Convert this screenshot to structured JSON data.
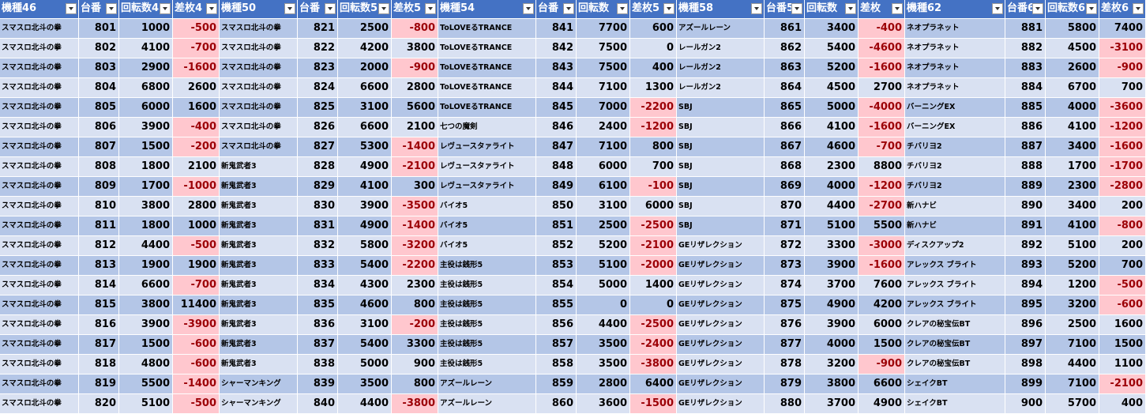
{
  "sheet": {
    "headers": [
      "機種46",
      "台番",
      "回転数4",
      "差枚4",
      "機種50",
      "台番",
      "回転数5",
      "差枚5",
      "機種54",
      "台番",
      "回転数",
      "差枚5",
      "機種58",
      "台番5",
      "回転数",
      "差枚",
      "機種62",
      "台番6",
      "回転数6",
      "差枚6"
    ],
    "rows": [
      [
        "スマスロ北斗の拳",
        "801",
        "1000",
        "-500",
        "スマスロ北斗の拳",
        "821",
        "2500",
        "-800",
        "ToLOVEるTRANCE",
        "841",
        "7700",
        "600",
        "アズールレーン",
        "861",
        "3400",
        "-400",
        "ネオプラネット",
        "881",
        "5800",
        "7400"
      ],
      [
        "スマスロ北斗の拳",
        "802",
        "4100",
        "-700",
        "スマスロ北斗の拳",
        "822",
        "4200",
        "3800",
        "ToLOVEるTRANCE",
        "842",
        "7500",
        "0",
        "レールガン2",
        "862",
        "5400",
        "-4600",
        "ネオプラネット",
        "882",
        "4500",
        "-3100"
      ],
      [
        "スマスロ北斗の拳",
        "803",
        "2900",
        "-1600",
        "スマスロ北斗の拳",
        "823",
        "2000",
        "-900",
        "ToLOVEるTRANCE",
        "843",
        "7500",
        "400",
        "レールガン2",
        "863",
        "5200",
        "-1600",
        "ネオプラネット",
        "883",
        "2600",
        "-900"
      ],
      [
        "スマスロ北斗の拳",
        "804",
        "6800",
        "2600",
        "スマスロ北斗の拳",
        "824",
        "6600",
        "2800",
        "ToLOVEるTRANCE",
        "844",
        "7100",
        "1300",
        "レールガン2",
        "864",
        "4500",
        "2700",
        "ネオプラネット",
        "884",
        "6700",
        "700"
      ],
      [
        "スマスロ北斗の拳",
        "805",
        "6000",
        "1600",
        "スマスロ北斗の拳",
        "825",
        "3100",
        "5600",
        "ToLOVEるTRANCE",
        "845",
        "7000",
        "-2200",
        "SBJ",
        "865",
        "5000",
        "-4000",
        "バーニングEX",
        "885",
        "4000",
        "-3600"
      ],
      [
        "スマスロ北斗の拳",
        "806",
        "3900",
        "-400",
        "スマスロ北斗の拳",
        "826",
        "6600",
        "2100",
        "七つの魔剣",
        "846",
        "2400",
        "-1200",
        "SBJ",
        "866",
        "4100",
        "-1600",
        "バーニングEX",
        "886",
        "4100",
        "-1200"
      ],
      [
        "スマスロ北斗の拳",
        "807",
        "1500",
        "-200",
        "スマスロ北斗の拳",
        "827",
        "5300",
        "-1400",
        "レヴュースタァライト",
        "847",
        "7100",
        "800",
        "SBJ",
        "867",
        "4600",
        "-700",
        "チバリヨ2",
        "887",
        "3400",
        "-1600"
      ],
      [
        "スマスロ北斗の拳",
        "808",
        "1800",
        "2100",
        "新鬼武者3",
        "828",
        "4900",
        "-2100",
        "レヴュースタァライト",
        "848",
        "6000",
        "700",
        "SBJ",
        "868",
        "2300",
        "8800",
        "チバリヨ2",
        "888",
        "1700",
        "-1700"
      ],
      [
        "スマスロ北斗の拳",
        "809",
        "1700",
        "-1000",
        "新鬼武者3",
        "829",
        "4100",
        "300",
        "レヴュースタァライト",
        "849",
        "6100",
        "-100",
        "SBJ",
        "869",
        "4000",
        "-1200",
        "チバリヨ2",
        "889",
        "2300",
        "-2800"
      ],
      [
        "スマスロ北斗の拳",
        "810",
        "3800",
        "2800",
        "新鬼武者3",
        "830",
        "3900",
        "-3500",
        "バイオ5",
        "850",
        "3100",
        "6000",
        "SBJ",
        "870",
        "4400",
        "-2700",
        "新ハナビ",
        "890",
        "3400",
        "200"
      ],
      [
        "スマスロ北斗の拳",
        "811",
        "1800",
        "1000",
        "新鬼武者3",
        "831",
        "4900",
        "-1400",
        "バイオ5",
        "851",
        "2500",
        "-2500",
        "SBJ",
        "871",
        "5100",
        "5500",
        "新ハナビ",
        "891",
        "4100",
        "-800"
      ],
      [
        "スマスロ北斗の拳",
        "812",
        "4400",
        "-500",
        "新鬼武者3",
        "832",
        "5800",
        "-3200",
        "バイオ5",
        "852",
        "5200",
        "-2100",
        "GEリザレクション",
        "872",
        "3300",
        "-3000",
        "ディスクアップ2",
        "892",
        "5100",
        "200"
      ],
      [
        "スマスロ北斗の拳",
        "813",
        "1900",
        "1900",
        "新鬼武者3",
        "833",
        "5400",
        "-2200",
        "主役は銭形5",
        "853",
        "5100",
        "-2000",
        "GEリザレクション",
        "873",
        "3900",
        "-1600",
        "アレックス ブライト",
        "893",
        "5200",
        "700"
      ],
      [
        "スマスロ北斗の拳",
        "814",
        "6600",
        "-700",
        "新鬼武者3",
        "834",
        "4300",
        "2300",
        "主役は銭形5",
        "854",
        "5000",
        "1400",
        "GEリザレクション",
        "874",
        "3700",
        "7600",
        "アレックス ブライト",
        "894",
        "1200",
        "-500"
      ],
      [
        "スマスロ北斗の拳",
        "815",
        "3800",
        "11400",
        "新鬼武者3",
        "835",
        "4600",
        "800",
        "主役は銭形5",
        "855",
        "0",
        "0",
        "GEリザレクション",
        "875",
        "4900",
        "4200",
        "アレックス ブライト",
        "895",
        "3200",
        "-600"
      ],
      [
        "スマスロ北斗の拳",
        "816",
        "3900",
        "-3900",
        "新鬼武者3",
        "836",
        "3100",
        "-200",
        "主役は銭形5",
        "856",
        "4400",
        "-2500",
        "GEリザレクション",
        "876",
        "3900",
        "6000",
        "クレアの秘宝伝BT",
        "896",
        "2500",
        "1600"
      ],
      [
        "スマスロ北斗の拳",
        "817",
        "1500",
        "-600",
        "新鬼武者3",
        "837",
        "5400",
        "3300",
        "主役は銭形5",
        "857",
        "3500",
        "-2400",
        "GEリザレクション",
        "877",
        "4000",
        "1500",
        "クレアの秘宝伝BT",
        "897",
        "7100",
        "1500"
      ],
      [
        "スマスロ北斗の拳",
        "818",
        "4800",
        "-600",
        "新鬼武者3",
        "838",
        "5000",
        "900",
        "主役は銭形5",
        "858",
        "3500",
        "-3800",
        "GEリザレクション",
        "878",
        "3200",
        "-900",
        "クレアの秘宝伝BT",
        "898",
        "4400",
        "1100"
      ],
      [
        "スマスロ北斗の拳",
        "819",
        "5500",
        "-1400",
        "シャーマンキング",
        "839",
        "3500",
        "800",
        "アズールレーン",
        "859",
        "2800",
        "6400",
        "GEリザレクション",
        "879",
        "3800",
        "6600",
        "シェイクBT",
        "899",
        "7100",
        "-2100"
      ],
      [
        "スマスロ北斗の拳",
        "820",
        "5100",
        "-500",
        "シャーマンキング",
        "840",
        "4400",
        "-3800",
        "アズールレーン",
        "860",
        "3600",
        "-1500",
        "GEリザレクション",
        "880",
        "3700",
        "4900",
        "シェイクBT",
        "900",
        "5700",
        "400"
      ]
    ]
  },
  "colors": {
    "header_bg": "#4472c4",
    "row_dark": "#b4c6e7",
    "row_light": "#d9e1f2",
    "negative_bg": "#ffc7ce",
    "negative_text": "#9c0006"
  }
}
